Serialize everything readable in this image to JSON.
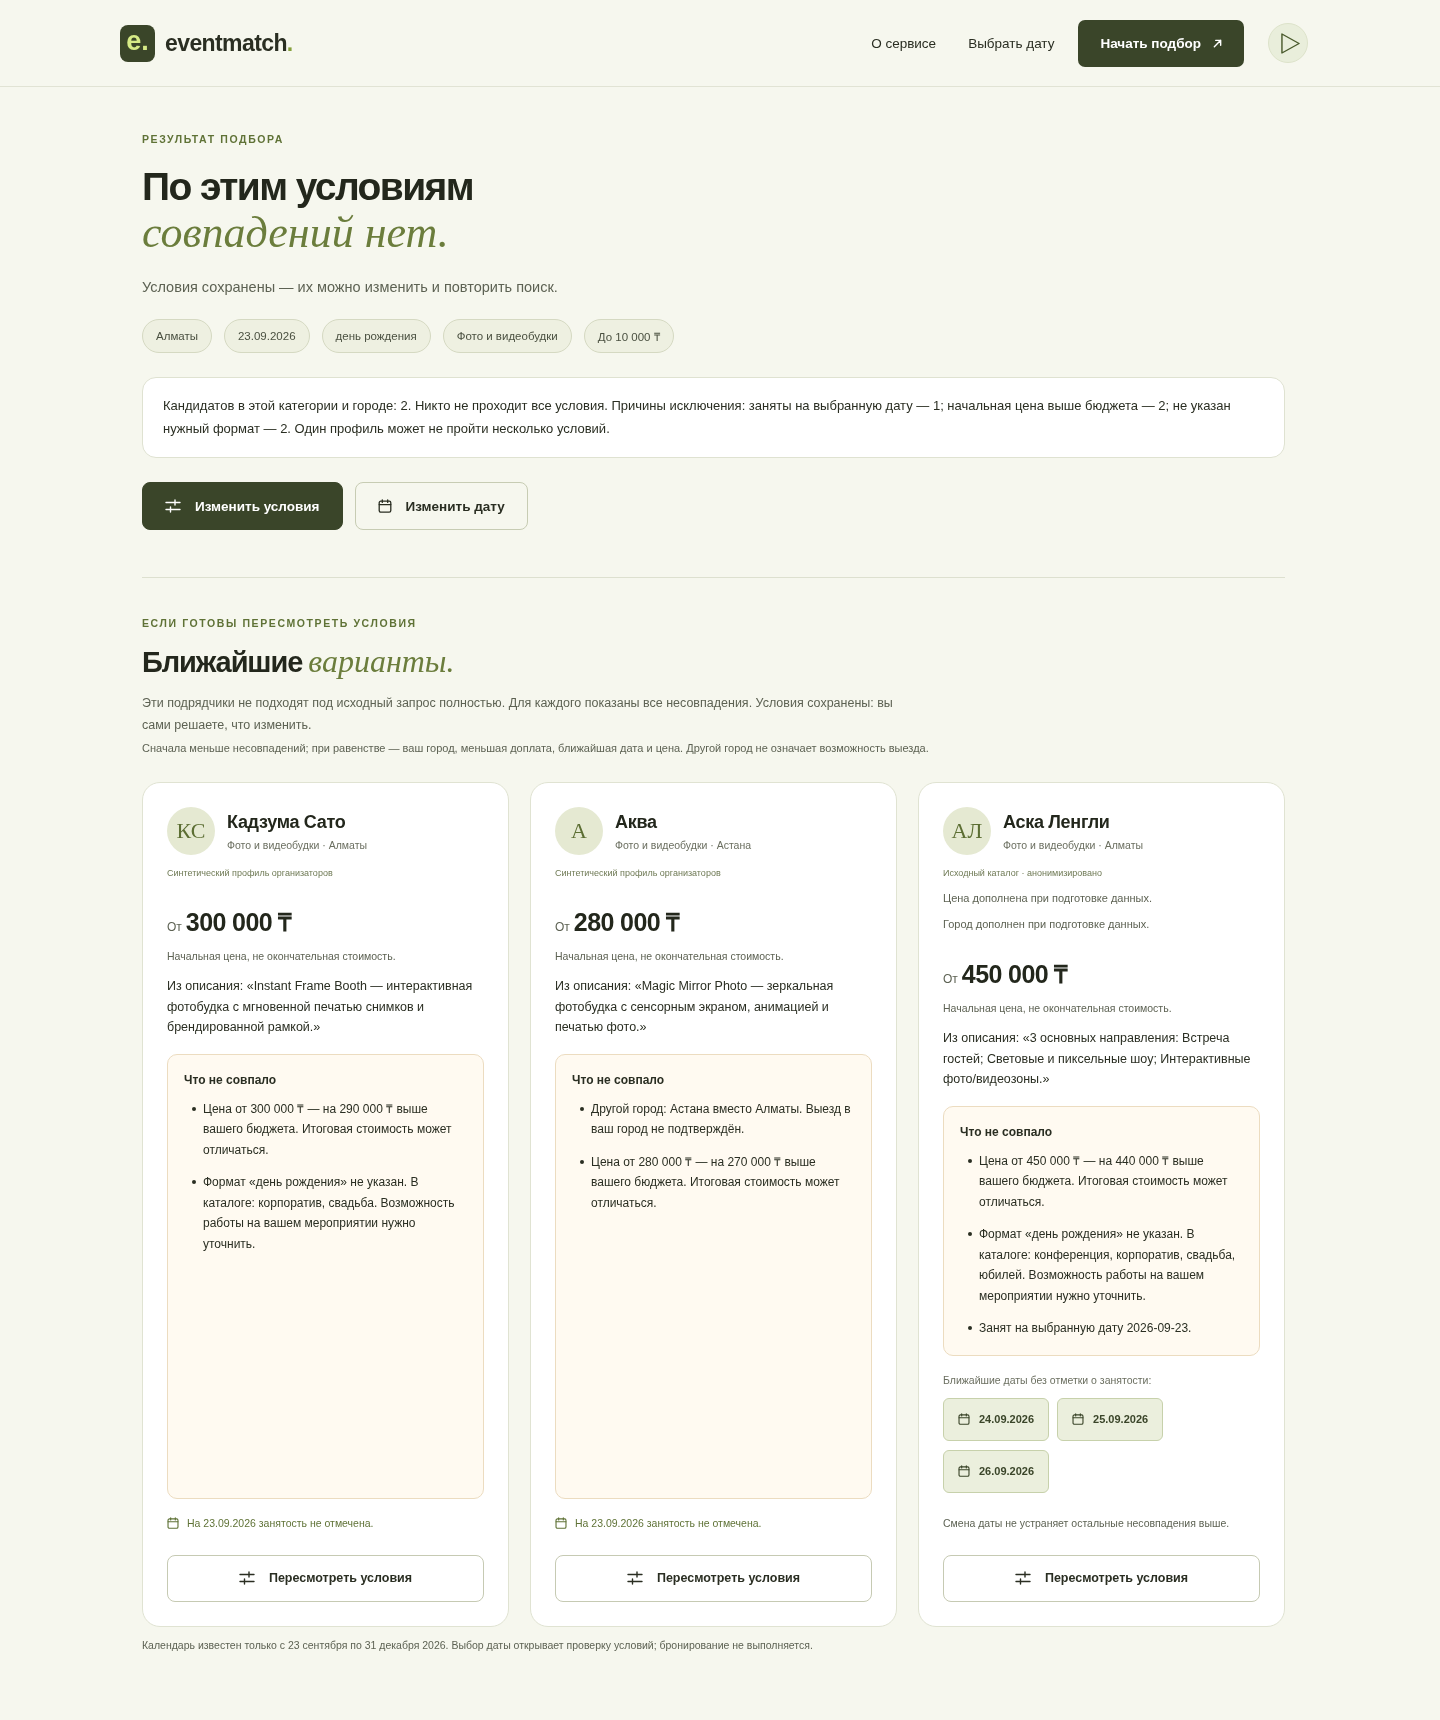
{
  "header": {
    "logo": {
      "mark": "e.",
      "name": "eventmatch",
      "suffix": "."
    },
    "nav": [
      "О сервисе",
      "Выбрать дату"
    ],
    "cta": "Начать подбор"
  },
  "result": {
    "eyebrow": "РЕЗУЛЬТАТ ПОДБОРА",
    "title": "По этим условиям",
    "title_accent": "совпадений нет.",
    "subtitle": "Условия сохранены — их можно изменить и повторить поиск.",
    "filters": [
      "Алматы",
      "23.09.2026",
      "день рождения",
      "Фото и видеобудки",
      "До 10 000 ₸"
    ],
    "summary": "Кандидатов в этой категории и городе: 2. Никто не проходит все условия. Причины исключения: заняты на выбранную дату — 1; начальная цена выше бюджета — 2; не указан нужный формат — 2. Один профиль может не пройти несколько условий.",
    "actions": [
      {
        "kind": "conditions",
        "label": "Изменить условия"
      },
      {
        "kind": "date",
        "label": "Изменить дату"
      }
    ]
  },
  "alternatives": {
    "eyebrow": "ЕСЛИ ГОТОВЫ ПЕРЕСМОТРЕТЬ УСЛОВИЯ",
    "title": "Ближайшие",
    "title_accent": "варианты.",
    "intro": "Эти подрядчики не подходят под исходный запрос полностью. Для каждого показаны все несовпадения. Условия сохранены: вы сами решаете, что изменить.",
    "sort_note": "Сначала меньше несовпадений; при равенстве — ваш город, меньшая доплата, ближайшая дата и цена. Другой город не означает возможность выезда.",
    "cards": [
      {
        "initials": "КС",
        "name": "Кадзума Сато",
        "meta": "Фото и видеобудки · Алматы",
        "source": "Синтетический профиль организаторов",
        "price_prefix": "От",
        "price": "300 000 ₸",
        "price_note": "Начальная цена, не окончательная стоимость.",
        "description": "Из описания: «Instant Frame Booth — интерактивная фотобудка с мгновенной печатью снимков и брендированной рамкой.»",
        "mismatch_title": "Что не совпало",
        "mismatches": [
          "Цена от 300 000 ₸ — на 290 000 ₸ выше вашего бюджета. Итоговая стоимость может отличаться.",
          "Формат «день рождения» не указан. В каталоге: корпоратив, свадьба. Возможность работы на вашем мероприятии нужно уточнить."
        ],
        "availability": {
          "kind": "unmarked",
          "text": "На 23.09.2026 занятость не отмечена."
        },
        "button": "Пересмотреть условия"
      },
      {
        "initials": "А",
        "name": "Аква",
        "meta": "Фото и видеобудки · Астана",
        "source": "Синтетический профиль организаторов",
        "price_prefix": "От",
        "price": "280 000 ₸",
        "price_note": "Начальная цена, не окончательная стоимость.",
        "description": "Из описания: «Magic Mirror Photo — зеркальная фотобудка с сенсорным экраном, анимацией и печатью фото.»",
        "mismatch_title": "Что не совпало",
        "mismatches": [
          "Другой город: Астана вместо Алматы. Выезд в ваш город не подтверждён.",
          "Цена от 280 000 ₸ — на 270 000 ₸ выше вашего бюджета. Итоговая стоимость может отличаться."
        ],
        "availability": {
          "kind": "unmarked",
          "text": "На 23.09.2026 занятость не отмечена."
        },
        "button": "Пересмотреть условия"
      },
      {
        "initials": "АЛ",
        "name": "Аска Ленгли",
        "meta": "Фото и видеобудки · Алматы",
        "source": "Исходный каталог · анонимизировано",
        "data_notes": [
          "Цена дополнена при подготовке данных.",
          "Город дополнен при подготовке данных."
        ],
        "price_prefix": "От",
        "price": "450 000 ₸",
        "price_note": "Начальная цена, не окончательная стоимость.",
        "description": "Из описания: «3 основных направления: Встреча гостей; Световые и пиксельные шоу; Интерактивные фото/видеозоны.»",
        "mismatch_title": "Что не совпало",
        "mismatches": [
          "Цена от 450 000 ₸ — на 440 000 ₸ выше вашего бюджета. Итоговая стоимость может отличаться.",
          "Формат «день рождения» не указан. В каталоге: конференция, корпоратив, свадьба, юбилей. Возможность работы на вашем мероприятии нужно уточнить.",
          "Занят на выбранную дату 2026-09-23."
        ],
        "availability": {
          "kind": "alternatives",
          "label": "Ближайшие даты без отметки о занятости:",
          "dates": [
            "24.09.2026",
            "25.09.2026",
            "26.09.2026"
          ],
          "note": "Смена даты не устраняет остальные несовпадения выше."
        },
        "button": "Пересмотреть условия"
      }
    ]
  },
  "footer_note": "Календарь известен только с 23 сентября по 31 декабря 2026. Выбор даты открывает проверку условий; бронирование не выполняется."
}
